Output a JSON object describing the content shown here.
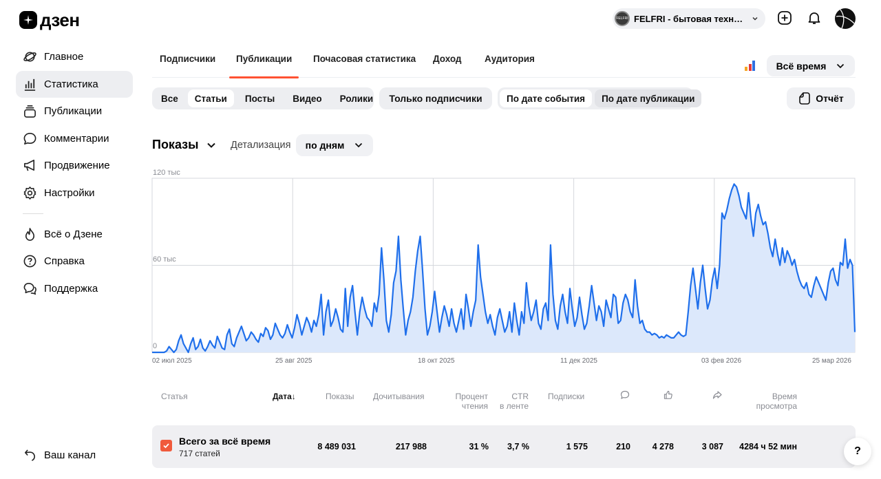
{
  "logo": {
    "text": "дзен"
  },
  "header": {
    "channel_avatar_text": "FELFRI",
    "channel_name": "FELFRI - бытовая техника…",
    "icons": [
      "add-icon",
      "bell-icon",
      "avatar"
    ]
  },
  "sidebar": {
    "items": [
      {
        "label": "Главное",
        "icon": "planet-icon"
      },
      {
        "label": "Статистика",
        "icon": "stats-icon",
        "active": true
      },
      {
        "label": "Публикации",
        "icon": "publications-icon"
      },
      {
        "label": "Комментарии",
        "icon": "comment-icon"
      },
      {
        "label": "Продвижение",
        "icon": "megaphone-icon"
      },
      {
        "label": "Настройки",
        "icon": "gear-icon"
      }
    ],
    "secondary": [
      {
        "label": "Всё о Дзене",
        "icon": "flame-icon"
      },
      {
        "label": "Справка",
        "icon": "help-icon"
      },
      {
        "label": "Поддержка",
        "icon": "support-icon"
      }
    ],
    "bottom": {
      "label": "Ваш канал",
      "icon": "back-icon"
    }
  },
  "tabs": [
    "Подписчики",
    "Публикации",
    "Почасовая статистика",
    "Доход",
    "Аудитория"
  ],
  "active_tab": "Публикации",
  "period": {
    "label": "Всё время"
  },
  "filters": {
    "types": [
      "Все",
      "Статьи",
      "Посты",
      "Видео",
      "Ролики"
    ],
    "active_type": "Статьи",
    "subscribers_only": "Только подписчики",
    "date_modes": [
      "По дате события",
      "По дате публикации"
    ],
    "active_date_mode": "По дате события",
    "report": "Отчёт"
  },
  "metric": {
    "label": "Показы",
    "detail_label": "Детализация",
    "detail_value": "по дням"
  },
  "chart_data": {
    "type": "area",
    "title": "",
    "xlabel": "",
    "ylabel": "",
    "ylim": [
      0,
      120000
    ],
    "y_tick_labels": [
      "120 тыс",
      "60 тыс",
      "0"
    ],
    "x_tick_labels": [
      "02 июл 2025",
      "25 авг 2025",
      "18 окт 2025",
      "11 дек 2025",
      "03 фев 2026",
      "25 мар 2026"
    ],
    "x_start": "2025-07-02",
    "x_end": "2026-03-25",
    "grid": true,
    "color": "#1f6feb",
    "fill": "#dce8fb",
    "values": [
      0,
      0,
      0,
      0,
      0,
      0,
      1000,
      4000,
      2000,
      0,
      2000,
      8000,
      12000,
      6000,
      3000,
      0,
      6000,
      10000,
      2000,
      4000,
      9000,
      3000,
      1000,
      4000,
      8000,
      5000,
      3000,
      11000,
      7000,
      3000,
      2000,
      12000,
      16000,
      6000,
      4000,
      10000,
      14000,
      18000,
      13000,
      8000,
      10000,
      14000,
      12000,
      9000,
      7000,
      13000,
      11000,
      17000,
      15000,
      9000,
      12000,
      20000,
      16000,
      12000,
      10000,
      13000,
      19000,
      14000,
      10000,
      17000,
      26000,
      20000,
      12000,
      18000,
      24000,
      20000,
      14000,
      22000,
      18000,
      26000,
      40000,
      12000,
      28000,
      36000,
      18000,
      22000,
      30000,
      24000,
      16000,
      14000,
      44000,
      18000,
      38000,
      46000,
      28000,
      12000,
      28000,
      38000,
      30000,
      24000,
      22000,
      18000,
      34000,
      28000,
      40000,
      72000,
      50000,
      22000,
      14000,
      26000,
      48000,
      56000,
      80000,
      50000,
      30000,
      12000,
      22000,
      28000,
      38000,
      56000,
      70000,
      80000,
      56000,
      30000,
      12000,
      18000,
      28000,
      42000,
      28000,
      14000,
      24000,
      32000,
      26000,
      18000,
      30000,
      20000,
      14000,
      22000,
      30000,
      16000,
      40000,
      30000,
      18000,
      28000,
      36000,
      74000,
      52000,
      40000,
      28000,
      20000,
      26000,
      18000,
      12000,
      24000,
      30000,
      22000,
      14000,
      18000,
      28000,
      14000,
      34000,
      22000,
      12000,
      28000,
      20000,
      48000,
      32000,
      22000,
      28000,
      36000,
      20000,
      16000,
      30000,
      34000,
      22000,
      74000,
      40000,
      22000,
      16000,
      32000,
      40000,
      28000,
      20000,
      44000,
      30000,
      18000,
      24000,
      38000,
      26000,
      16000,
      20000,
      32000,
      46000,
      34000,
      22000,
      32000,
      28000,
      18000,
      36000,
      30000,
      24000,
      40000,
      38000,
      20000,
      22000,
      34000,
      40000,
      36000,
      28000,
      24000,
      50000,
      32000,
      20000,
      22000,
      16000,
      14000,
      14000,
      12000,
      13000,
      12000,
      10000,
      11000,
      10000,
      12000,
      11000,
      10000,
      10000,
      12000,
      14000,
      12000,
      11000,
      12000,
      28000,
      46000,
      58000,
      44000,
      30000,
      48000,
      60000,
      44000,
      30000,
      36000,
      50000,
      58000,
      44000,
      60000,
      96000,
      92000,
      98000,
      106000,
      112000,
      116000,
      114000,
      108000,
      100000,
      96000,
      92000,
      110000,
      92000,
      80000,
      96000,
      102000,
      94000,
      88000,
      90000,
      82000,
      72000,
      66000,
      78000,
      68000,
      60000,
      72000,
      62000,
      70000,
      66000,
      60000,
      64000,
      56000,
      50000,
      46000,
      44000,
      48000,
      40000,
      38000,
      46000,
      52000,
      48000,
      44000,
      40000,
      36000,
      48000,
      56000,
      58000,
      50000,
      46000,
      62000,
      60000,
      78000,
      58000,
      64000,
      60000,
      14000
    ]
  },
  "table": {
    "headers": {
      "article": "Статья",
      "date": "Дата",
      "date_sort": "↓",
      "views": "Показы",
      "reads": "Дочитывания",
      "read_pct_1": "Процент",
      "read_pct_2": "чтения",
      "ctr_1": "CTR",
      "ctr_2": "в ленте",
      "subs": "Подписки",
      "time_1": "Время",
      "time_2": "просмотра"
    },
    "header_icons": [
      "comment-icon",
      "like-icon",
      "share-icon"
    ],
    "total": {
      "title": "Всего за всё время",
      "subtitle": "717 статей",
      "views": "8 489 031",
      "reads": "217 988",
      "read_pct": "31 %",
      "ctr": "3,7 %",
      "subs": "1 575",
      "comments": "210",
      "likes": "4 278",
      "shares": "3 087",
      "time": "4284 ч 52 мин"
    }
  },
  "help": "?"
}
